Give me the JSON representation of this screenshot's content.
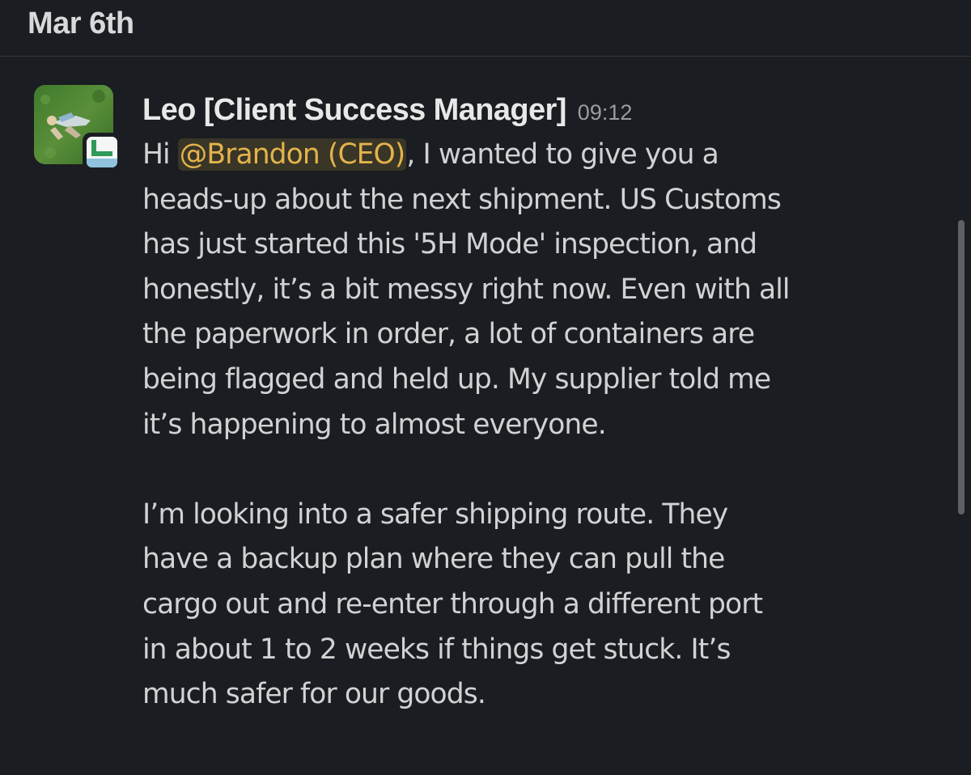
{
  "date_divider": {
    "label": "Mar 6th"
  },
  "message": {
    "sender": "Leo [Client Success Manager]",
    "time": "09:12",
    "avatar_icon": "person-lying-on-grass-avatar",
    "badge_icon": "green-status-app-badge-icon",
    "paragraphs": [
      {
        "lines": [
          {
            "before": "Hi ",
            "mention": "@Brandon (CEO)",
            "after": ", I wanted to give you a"
          },
          {
            "text": "heads-up about the next shipment. US Customs"
          },
          {
            "text": "has just started this '5H Mode' inspection, and"
          },
          {
            "text": "honestly, it’s a bit messy right now. Even with all"
          },
          {
            "text": "the paperwork in order, a lot of containers are"
          },
          {
            "text": "being flagged and held up. My supplier told me"
          },
          {
            "text": "it’s happening to almost everyone."
          }
        ]
      },
      {
        "lines": [
          {
            "text": "I’m looking into a safer shipping route. They"
          },
          {
            "text": "have a backup plan where they can pull the"
          },
          {
            "text": "cargo out and re-enter through a different port"
          },
          {
            "text": "in about 1 to 2 weeks if things get stuck. It’s"
          },
          {
            "text": "much safer for our goods."
          }
        ]
      }
    ]
  },
  "colors": {
    "background": "#1a1d21",
    "text": "#d1d2d3",
    "mention": "#e3b34b",
    "timestamp": "#9a9c9e"
  }
}
